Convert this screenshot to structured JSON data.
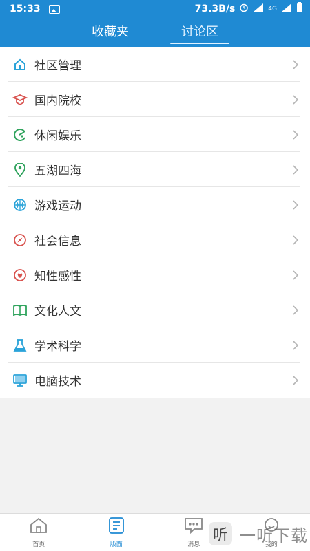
{
  "status": {
    "time": "15:33",
    "speed": "73.3B/s",
    "network_label": "4G"
  },
  "header": {
    "tabs": [
      {
        "label": "收藏夹",
        "active": false
      },
      {
        "label": "讨论区",
        "active": true
      }
    ]
  },
  "list": {
    "items": [
      {
        "label": "社区管理",
        "icon": "home-icon",
        "color": "#2aa3d9"
      },
      {
        "label": "国内院校",
        "icon": "graduation-cap-icon",
        "color": "#d9534f"
      },
      {
        "label": "休闲娱乐",
        "icon": "pacman-icon",
        "color": "#2fa35d"
      },
      {
        "label": "五湖四海",
        "icon": "location-pin-icon",
        "color": "#2fa35d"
      },
      {
        "label": "游戏运动",
        "icon": "basketball-icon",
        "color": "#2aa3d9"
      },
      {
        "label": "社会信息",
        "icon": "compass-icon",
        "color": "#d9534f"
      },
      {
        "label": "知性感性",
        "icon": "heart-icon",
        "color": "#d9534f"
      },
      {
        "label": "文化人文",
        "icon": "book-icon",
        "color": "#2fa35d"
      },
      {
        "label": "学术科学",
        "icon": "flask-icon",
        "color": "#2aa3d9"
      },
      {
        "label": "电脑技术",
        "icon": "monitor-icon",
        "color": "#2aa3d9"
      }
    ]
  },
  "bottom_nav": {
    "items": [
      {
        "label": "首页",
        "icon": "home-icon",
        "active": false
      },
      {
        "label": "版面",
        "icon": "document-icon",
        "active": true
      },
      {
        "label": "消息",
        "icon": "message-icon",
        "active": false
      },
      {
        "label": "我的",
        "icon": "user-icon",
        "active": false
      }
    ]
  },
  "watermark": {
    "badge": "听",
    "text": "一听下载"
  },
  "colors": {
    "primary": "#1f8ad3",
    "background": "#f2f2f2"
  }
}
